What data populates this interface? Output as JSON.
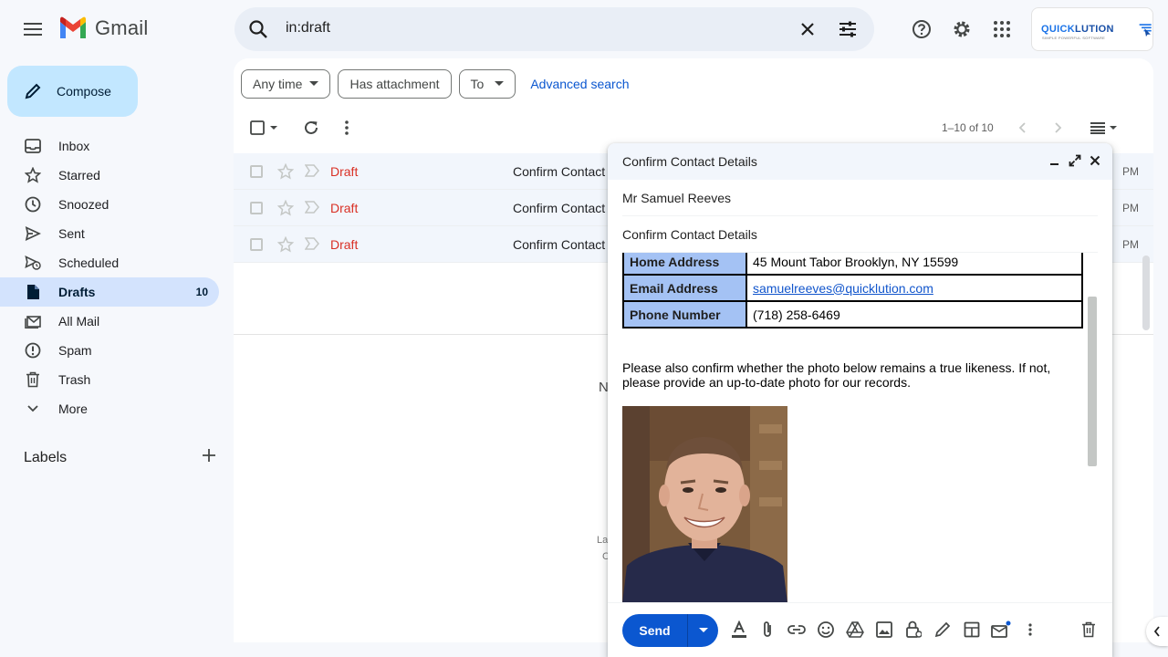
{
  "app": {
    "name": "Gmail"
  },
  "search": {
    "query": "in:draft"
  },
  "account": {
    "brand_a": "QUICK",
    "brand_b": "LUTION",
    "tagline": "SIMPLE POWERFUL SOFTWARE"
  },
  "compose_button": {
    "label": "Compose"
  },
  "nav": [
    {
      "label": "Inbox",
      "icon": "inbox-icon"
    },
    {
      "label": "Starred",
      "icon": "star-icon"
    },
    {
      "label": "Snoozed",
      "icon": "clock-icon"
    },
    {
      "label": "Sent",
      "icon": "send-icon"
    },
    {
      "label": "Scheduled",
      "icon": "scheduled-icon"
    },
    {
      "label": "Drafts",
      "icon": "draft-icon",
      "count": "10",
      "active": true
    },
    {
      "label": "All Mail",
      "icon": "all-mail-icon"
    },
    {
      "label": "Spam",
      "icon": "spam-icon"
    },
    {
      "label": "Trash",
      "icon": "trash-icon"
    },
    {
      "label": "More",
      "icon": "chevron-down-icon"
    }
  ],
  "labels": {
    "title": "Labels"
  },
  "filters": {
    "any_time": "Any time",
    "has_attachment": "Has attachment",
    "to": "To",
    "advanced": "Advanced search"
  },
  "pager": {
    "text": "1–10 of 10"
  },
  "rows": [
    {
      "status": "Draft",
      "subject": "Confirm Contact",
      "time": "PM"
    },
    {
      "status": "Draft",
      "subject": "Confirm Contact",
      "time": "PM"
    },
    {
      "status": "Draft",
      "subject": "Confirm Contact",
      "time": "PM"
    }
  ],
  "main_partial": {
    "n": "N",
    "la": "La",
    "c": "C"
  },
  "compose": {
    "title": "Confirm Contact Details",
    "to": "Mr Samuel Reeves",
    "subject": "Confirm Contact Details",
    "table": [
      {
        "key": "Home Address",
        "value": "45 Mount Tabor Brooklyn, NY 15599"
      },
      {
        "key": "Email Address",
        "value": "samuelreeves@quicklution.com",
        "link": true
      },
      {
        "key": "Phone Number",
        "value": "(718) 258-6469"
      }
    ],
    "note": "Please also confirm whether the photo below remains a true likeness. If not, please provide an up-to-date photo for our records.",
    "send_label": "Send"
  },
  "colors": {
    "accent": "#0b57d0",
    "draft_red": "#d93025",
    "table_key_bg": "#a4c2f4",
    "compose_btn": "#c2e7ff",
    "active_nav": "#d3e3fd"
  }
}
